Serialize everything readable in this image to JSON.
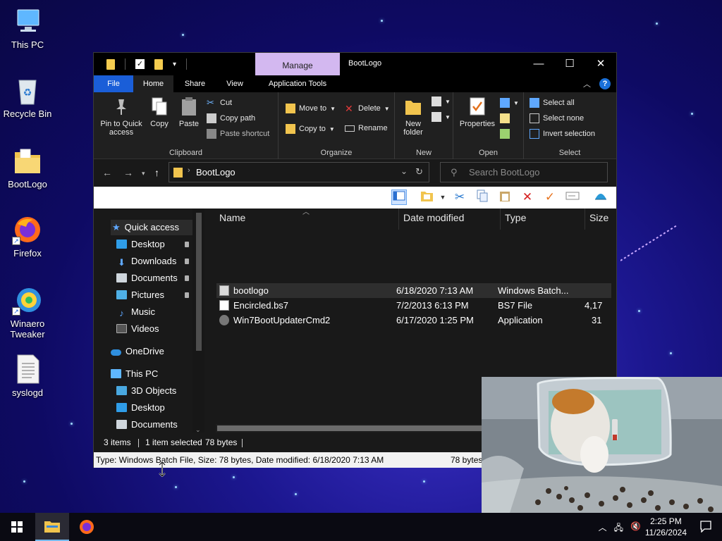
{
  "desktop": {
    "icons": [
      {
        "label": "This PC"
      },
      {
        "label": "Recycle Bin"
      },
      {
        "label": "BootLogo"
      },
      {
        "label": "Firefox"
      },
      {
        "label": "Winaero Tweaker"
      },
      {
        "label": "syslogd"
      }
    ]
  },
  "window": {
    "title": "BootLogo",
    "contextual_tab": "Manage",
    "tabs": [
      "File",
      "Home",
      "Share",
      "View",
      "Application Tools"
    ],
    "colors": {
      "file_tab": "#1a5ed8",
      "manage_tab": "#d3b8f0",
      "accent": "#1a70d8"
    },
    "ribbon": {
      "clipboard": {
        "title": "Clipboard",
        "pin": "Pin to Quick access",
        "copy": "Copy",
        "paste": "Paste",
        "cut": "Cut",
        "copy_path": "Copy path",
        "paste_shortcut": "Paste shortcut"
      },
      "organize": {
        "title": "Organize",
        "move_to": "Move to",
        "copy_to": "Copy to",
        "delete": "Delete",
        "rename": "Rename"
      },
      "new": {
        "title": "New",
        "new_folder": "New folder"
      },
      "open": {
        "title": "Open",
        "properties": "Properties"
      },
      "select": {
        "title": "Select",
        "select_all": "Select all",
        "select_none": "Select none",
        "invert": "Invert selection"
      }
    },
    "address": {
      "path": "BootLogo",
      "search_placeholder": "Search BootLogo"
    },
    "nav": [
      {
        "label": "Quick access",
        "pinned": false
      },
      {
        "label": "Desktop",
        "pinned": true
      },
      {
        "label": "Downloads",
        "pinned": true
      },
      {
        "label": "Documents",
        "pinned": true
      },
      {
        "label": "Pictures",
        "pinned": true
      },
      {
        "label": "Music",
        "pinned": false
      },
      {
        "label": "Videos",
        "pinned": false
      },
      {
        "label": "OneDrive",
        "pinned": false
      },
      {
        "label": "This PC",
        "pinned": false
      },
      {
        "label": "3D Objects",
        "pinned": false
      },
      {
        "label": "Desktop",
        "pinned": false
      },
      {
        "label": "Documents",
        "pinned": false
      }
    ],
    "columns": [
      "Name",
      "Date modified",
      "Type",
      "Size"
    ],
    "files": [
      {
        "name": "bootlogo",
        "date": "6/18/2020 7:13 AM",
        "type": "Windows Batch...",
        "size": "",
        "selected": true
      },
      {
        "name": "Encircled.bs7",
        "date": "7/2/2013 6:13 PM",
        "type": "BS7 File",
        "size": "4,17",
        "selected": false
      },
      {
        "name": "Win7BootUpdaterCmd2",
        "date": "6/17/2020 1:25 PM",
        "type": "Application",
        "size": "31",
        "selected": false
      }
    ],
    "status": {
      "count": "3 items",
      "selected": "1 item selected",
      "size": "78 bytes"
    },
    "details": {
      "text": "Type: Windows Batch File, Size: 78 bytes, Date modified: 6/18/2020 7:13 AM",
      "size": "78 bytes"
    }
  },
  "taskbar": {
    "time": "2:25 PM",
    "date": "11/26/2024"
  }
}
